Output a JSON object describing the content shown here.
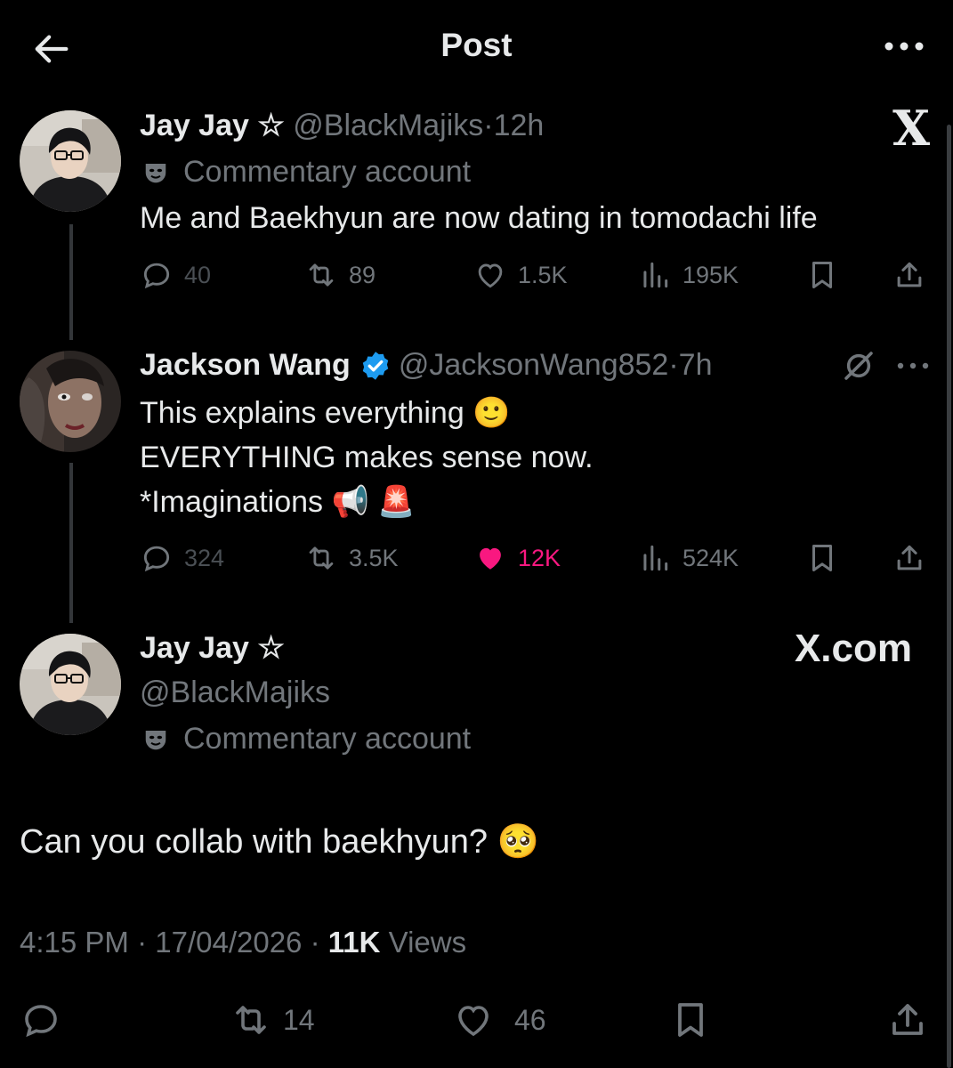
{
  "header": {
    "title": "Post"
  },
  "post1": {
    "name": "Jay Jay ☆",
    "handle": "@BlackMajiks",
    "separator": "·",
    "time": "12h",
    "label": "Commentary account",
    "text": "Me and Baekhyun are now dating in tomodachi life",
    "replies": "40",
    "reposts": "89",
    "likes": "1.5K",
    "views": "195K",
    "watermark": "X"
  },
  "post2": {
    "name": "Jackson Wang",
    "handle": "@JacksonWang852",
    "separator": "·",
    "time": "7h",
    "lines": [
      "This explains everything 🙂",
      "EVERYTHING makes sense now.",
      "*Imaginations 📢 🚨"
    ],
    "replies": "324",
    "reposts": "3.5K",
    "likes": "12K",
    "views": "524K",
    "liked": true
  },
  "post3": {
    "name": "Jay Jay ☆",
    "handle": "@BlackMajiks",
    "label": "Commentary account",
    "watermark": "X.com",
    "text": "Can you collab with baekhyun? 🥺",
    "time": "4:15 PM",
    "date": "17/04/2026",
    "separator": "·",
    "views_count": "11K",
    "views_label": "Views",
    "reposts": "14",
    "likes": "46"
  },
  "colors": {
    "accent": "#1d9bf0",
    "like": "#f91880",
    "muted": "#71767b",
    "text": "#e7e9ea"
  },
  "icons": [
    "back-arrow-icon",
    "more-icon",
    "mask-icon",
    "reply-icon",
    "repost-icon",
    "heart-icon",
    "views-icon",
    "bookmark-icon",
    "share-icon",
    "verified-icon",
    "grok-icon"
  ]
}
